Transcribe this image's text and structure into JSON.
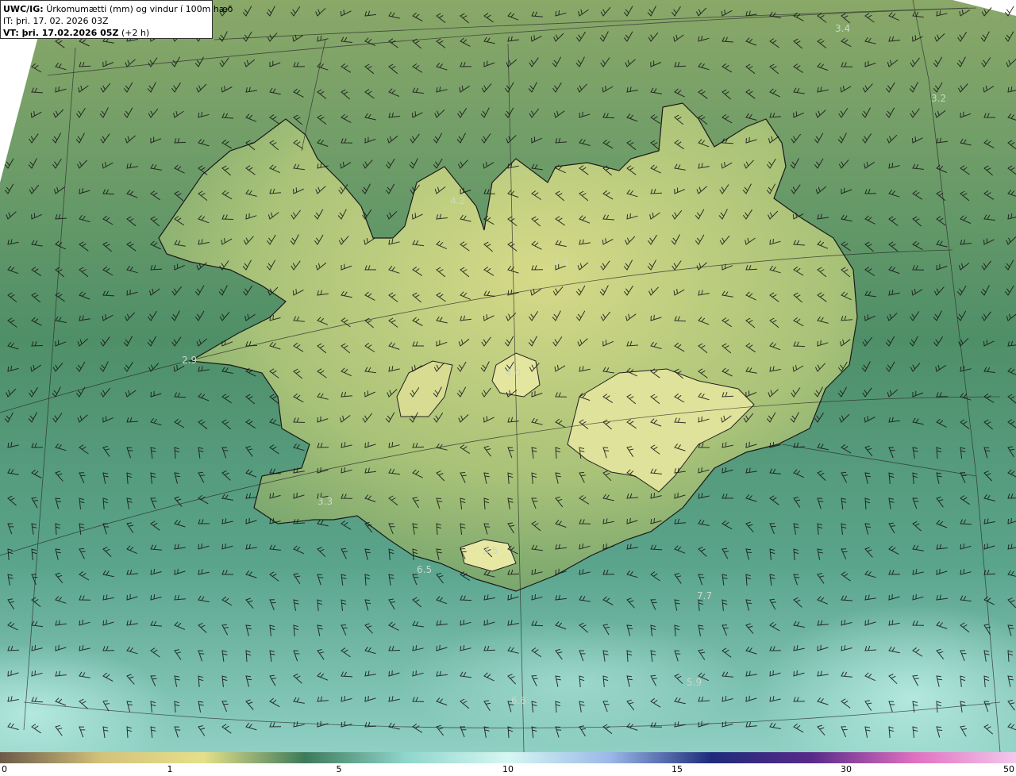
{
  "header": {
    "model_code": "UWC/IG:",
    "title": "Úrkomumætti (mm) og vindur í 100m hæð",
    "it_label": "IT:",
    "it_value": "þri. 17. 02. 2026 03Z",
    "vt_label": "VT: þri. 17.02.2026 05Z",
    "vt_offset": "(+2 h)"
  },
  "value_labels": [
    "3.4",
    "3.2",
    "4.2",
    "4.3",
    "2.9",
    "4.0",
    "3.3",
    "3.5",
    "6.5",
    "7.7",
    "5.9",
    "6.6"
  ],
  "colorbar": {
    "ticks": [
      "0",
      "1",
      "5",
      "10",
      "15",
      "30",
      "50"
    ],
    "colors": [
      "#6b5a48",
      "#d4c27a",
      "#e6e08a",
      "#3d7a5a",
      "#8fd6cc",
      "#d6f7f2",
      "#9ab8e8",
      "#1e2b7a",
      "#5a2a8a",
      "#e070c0",
      "#f4c8ec"
    ]
  },
  "colors": {
    "land_high": "#d9dc8c",
    "land_mid": "#9fbc72",
    "sea_dark": "#3a7a62",
    "sea_light": "#7cc6bc",
    "coast": "#1a1a1a",
    "barb": "#141414"
  }
}
